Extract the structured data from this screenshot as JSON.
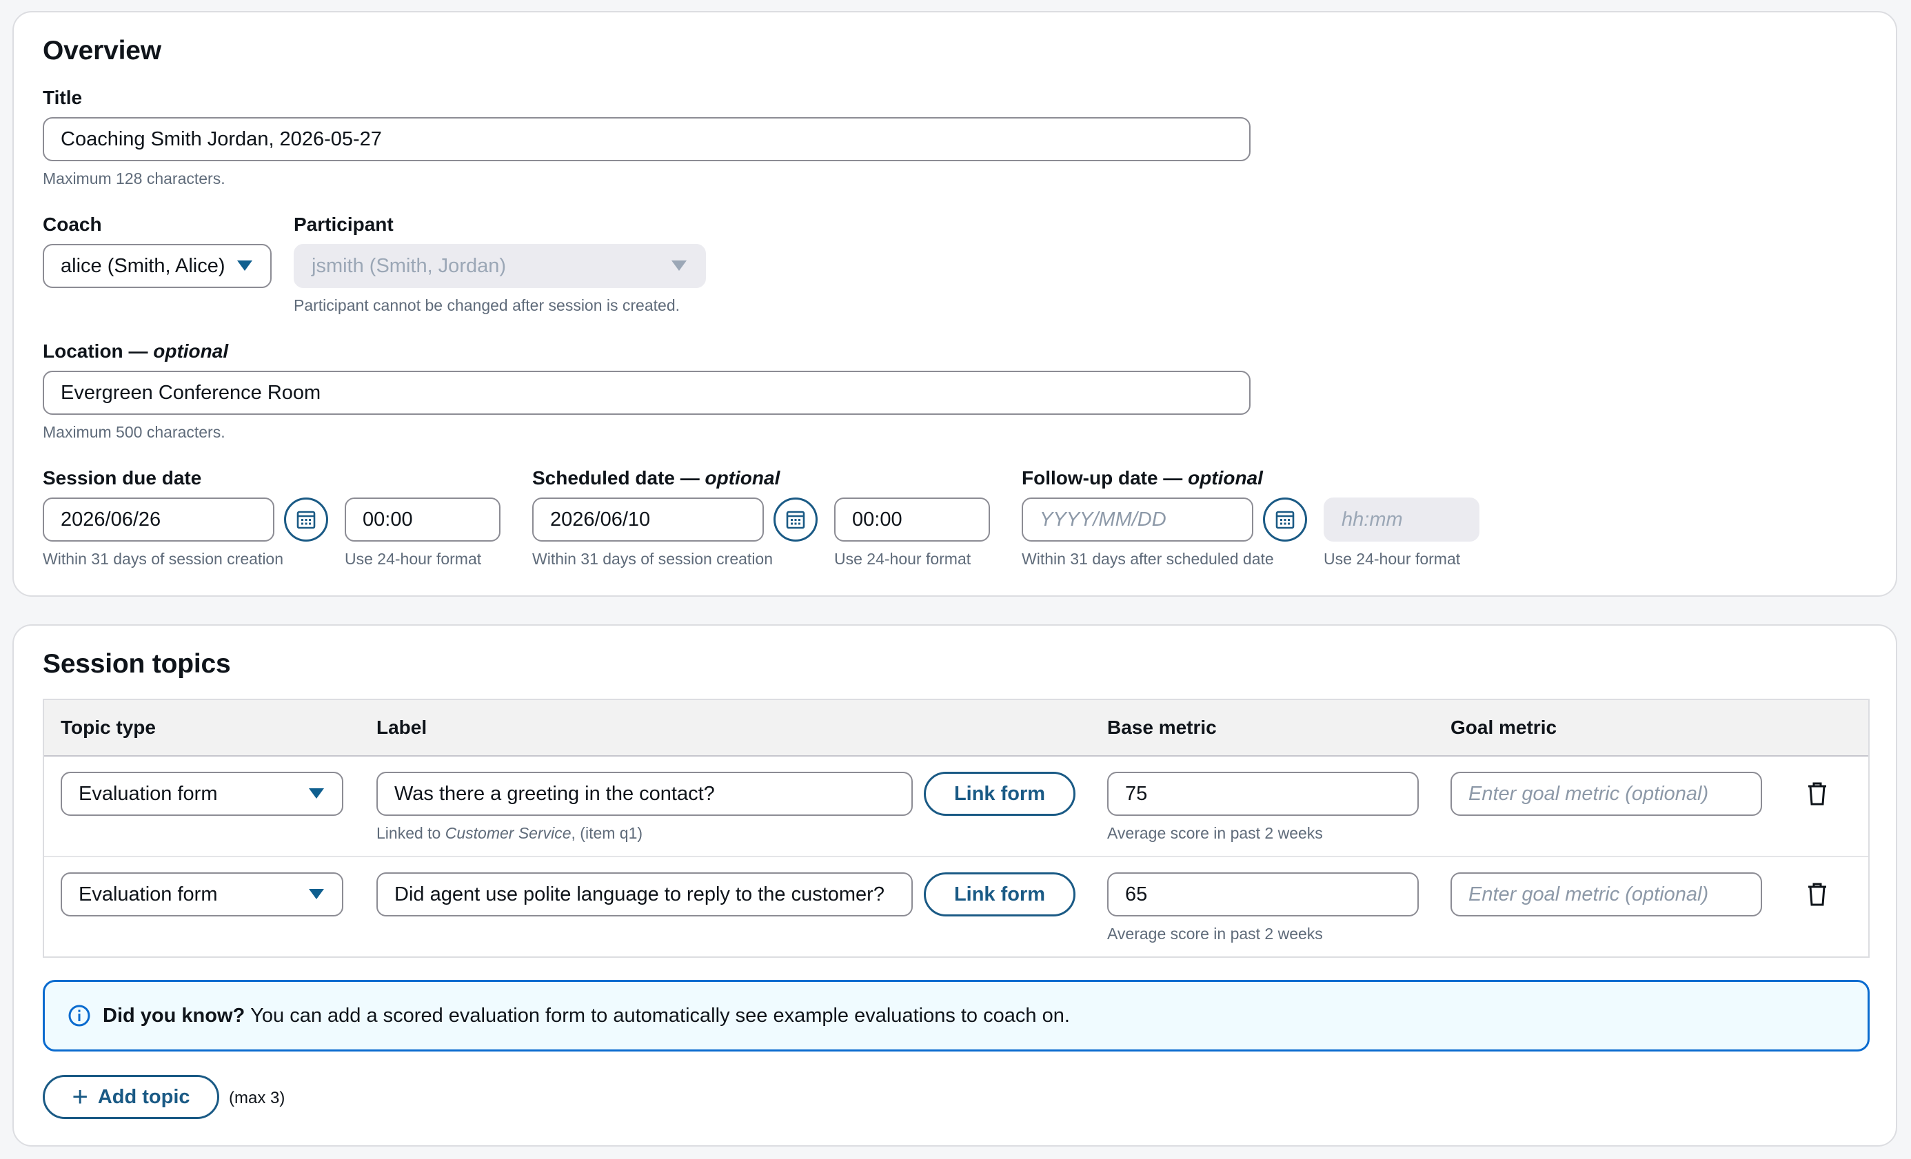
{
  "overview": {
    "heading": "Overview",
    "title_label": "Title",
    "title_value": "Coaching Smith Jordan, 2026-05-27",
    "title_hint": "Maximum 128 characters.",
    "coach_label": "Coach",
    "coach_value": "alice (Smith, Alice)",
    "participant_label": "Participant",
    "participant_value": "jsmith (Smith, Jordan)",
    "participant_hint": "Participant cannot be changed after session is created.",
    "location_label": "Location — ",
    "location_optional": "optional",
    "location_value": "Evergreen Conference Room",
    "location_hint": "Maximum 500 characters.",
    "due_label": "Session due date",
    "due_date": "2026/06/26",
    "due_time": "00:00",
    "due_date_hint": "Within 31 days of session creation",
    "due_time_hint": "Use 24-hour format",
    "scheduled_label": "Scheduled date — ",
    "scheduled_optional": "optional",
    "scheduled_date": "2026/06/10",
    "scheduled_time": "00:00",
    "scheduled_date_hint": "Within 31 days of session creation",
    "scheduled_time_hint": "Use 24-hour format",
    "followup_label": "Follow-up date — ",
    "followup_optional": "optional",
    "followup_date_placeholder": "YYYY/MM/DD",
    "followup_time_placeholder": "hh:mm",
    "followup_date_hint": "Within 31 days after scheduled date",
    "followup_time_hint": "Use 24-hour format"
  },
  "topics": {
    "heading": "Session topics",
    "columns": [
      "Topic type",
      "Label",
      "Base metric",
      "Goal metric"
    ],
    "rows": [
      {
        "type": "Evaluation form",
        "label": "Was there a greeting in the contact?",
        "link_button": "Link form",
        "linked_prefix": "Linked to ",
        "linked_form": "Customer Service",
        "linked_suffix": ", (item q1)",
        "base_metric": "75",
        "base_hint": "Average score in past 2 weeks",
        "goal_placeholder": "Enter goal metric (optional)"
      },
      {
        "type": "Evaluation form",
        "label": "Did agent use polite language to reply to the customer?",
        "link_button": "Link form",
        "base_metric": "65",
        "base_hint": "Average score in past 2 weeks",
        "goal_placeholder": "Enter goal metric (optional)"
      }
    ],
    "alert_bold": "Did you know?",
    "alert_text": "You can add a scored evaluation form to automatically see example evaluations to coach on.",
    "add_button": "Add topic",
    "add_note": "(max 3)"
  },
  "colors": {
    "accent": "#1a5a85",
    "info_border": "#0a6bcf",
    "info_bg": "#f0fbff"
  },
  "icons": [
    "calendar-icon",
    "trash-icon",
    "info-icon",
    "plus-icon",
    "caret-down-icon"
  ]
}
